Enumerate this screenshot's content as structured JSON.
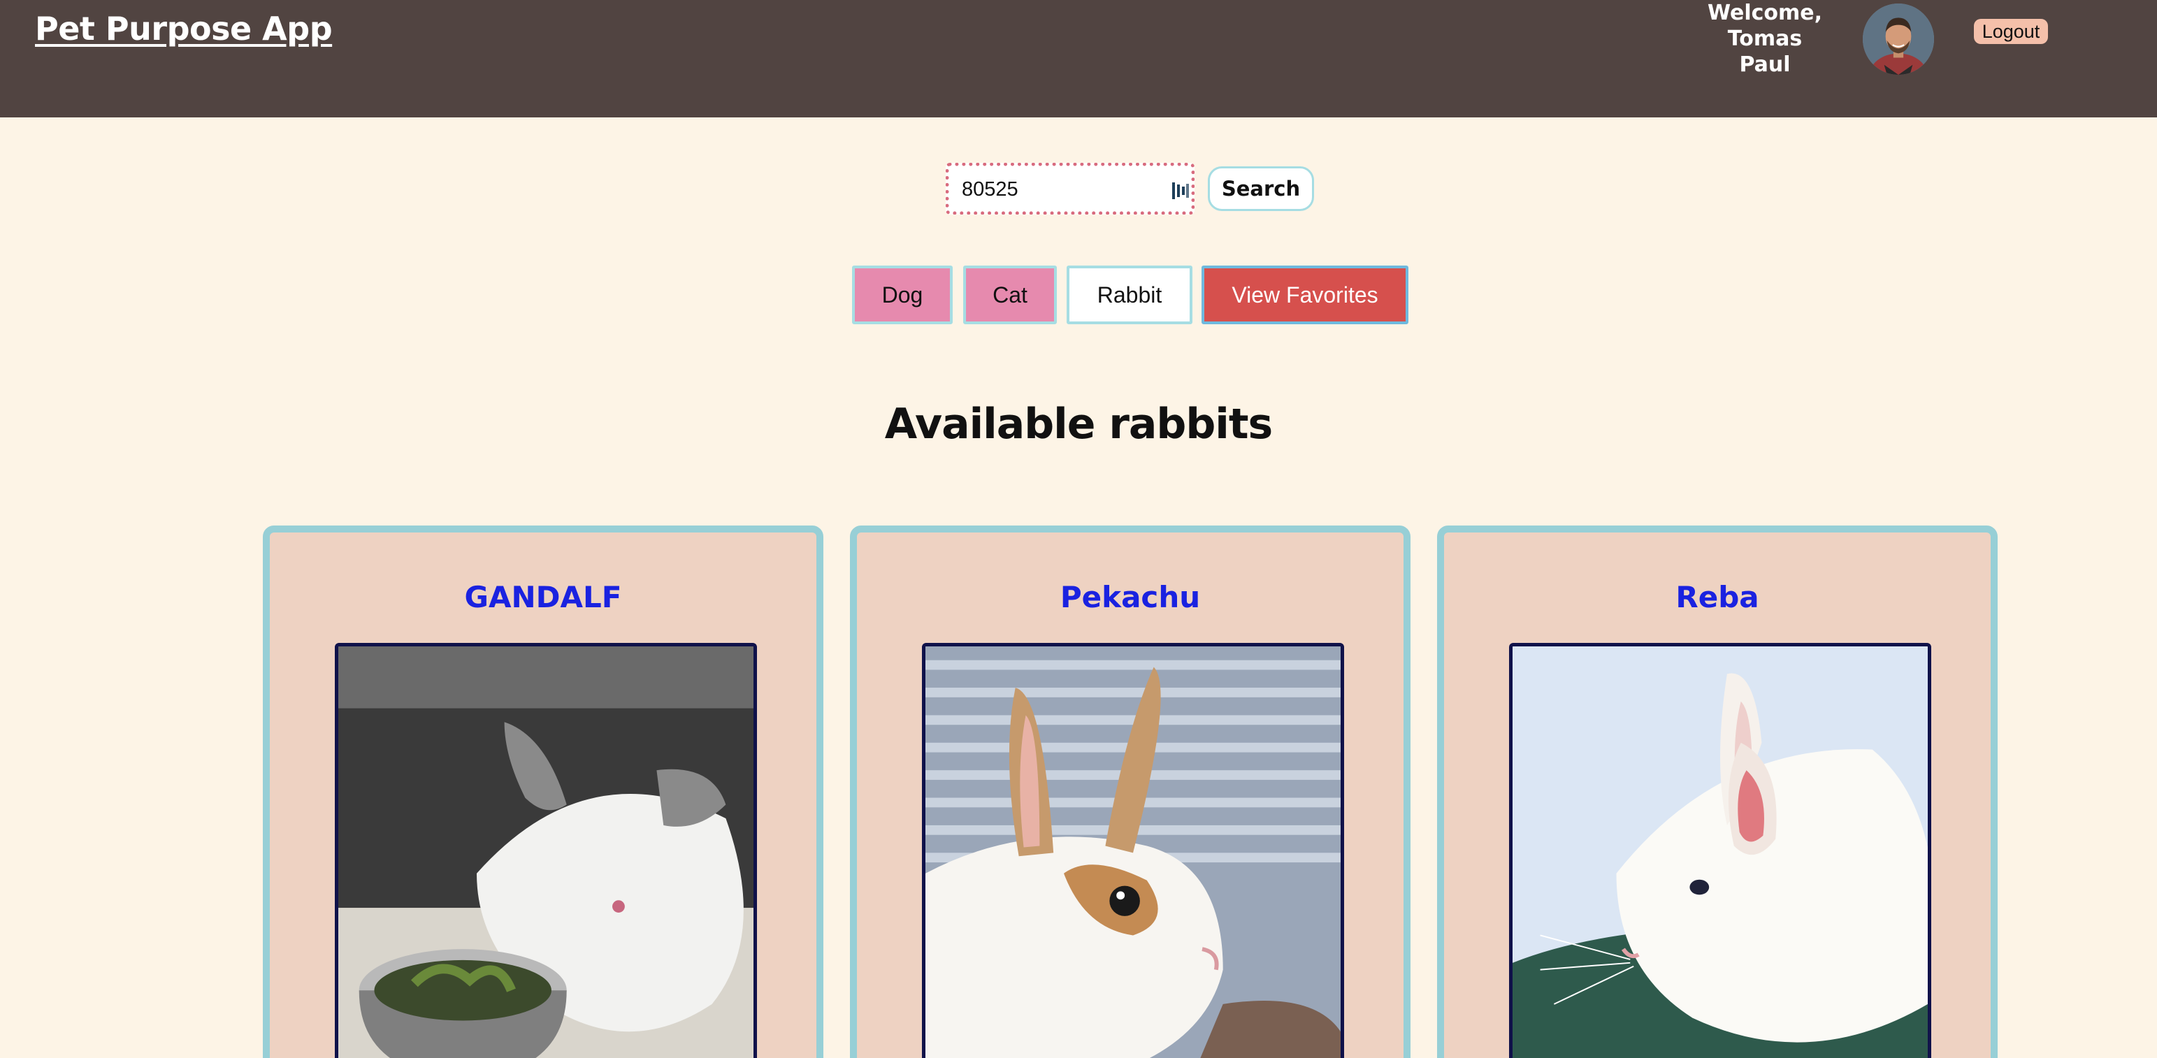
{
  "header": {
    "app_title": "Pet Purpose App",
    "welcome_line1": "Welcome,",
    "welcome_line2": "Tomas",
    "welcome_line3": "Paul",
    "logout_label": "Logout"
  },
  "search": {
    "zip_value": "80525",
    "button_label": "Search"
  },
  "filters": {
    "dog_label": "Dog",
    "cat_label": "Cat",
    "rabbit_label": "Rabbit",
    "favorites_label": "View Favorites"
  },
  "main": {
    "section_title": "Available rabbits",
    "pets": [
      {
        "name": "GANDALF"
      },
      {
        "name": "Pekachu"
      },
      {
        "name": "Reba"
      }
    ]
  },
  "colors": {
    "header_bg": "#514441",
    "page_bg": "#fdf4e6",
    "card_bg": "#eed2c2",
    "card_border": "#97cfd6",
    "pet_name": "#1a22e0",
    "filter_pink": "#e68aae",
    "favorites_red": "#d6504d"
  }
}
